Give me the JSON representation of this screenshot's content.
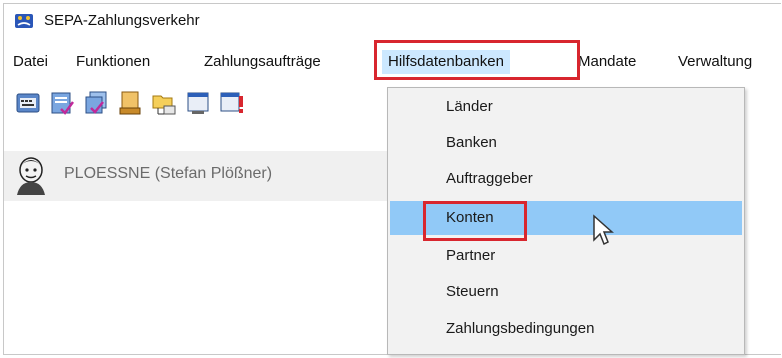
{
  "window": {
    "title": "SEPA-Zahlungsverkehr",
    "app_icon": "sepa-app-icon"
  },
  "menubar": {
    "items": [
      {
        "label": "Datei"
      },
      {
        "label": "Funktionen"
      },
      {
        "label": "Zahlungsaufträge"
      },
      {
        "label": "Hilfsdatenbanken",
        "active": true
      },
      {
        "label": "Mandate"
      },
      {
        "label": "Verwaltung"
      }
    ]
  },
  "toolbar": {
    "buttons": [
      {
        "icon": "keyboard-icon"
      },
      {
        "icon": "form-check-icon"
      },
      {
        "icon": "documents-check-icon"
      },
      {
        "icon": "stack-icon"
      },
      {
        "icon": "folder-network-icon"
      },
      {
        "icon": "window-icon"
      },
      {
        "icon": "window-alert-icon"
      }
    ]
  },
  "user": {
    "avatar_icon": "user-avatar-icon",
    "label": "PLOESSNE (Stefan Plößner)"
  },
  "dropdown": {
    "items": [
      {
        "label": "Länder"
      },
      {
        "label": "Banken"
      },
      {
        "label": "Auftraggeber"
      },
      {
        "label": "Konten",
        "selected": true
      },
      {
        "label": "Partner"
      },
      {
        "label": "Steuern"
      },
      {
        "label": "Zahlungsbedingungen"
      }
    ]
  },
  "colors": {
    "highlight_box": "#d8262e",
    "menu_active": "#cce8ff",
    "item_selected": "#91c9f7"
  },
  "cursor_icon": "mouse-pointer-icon"
}
